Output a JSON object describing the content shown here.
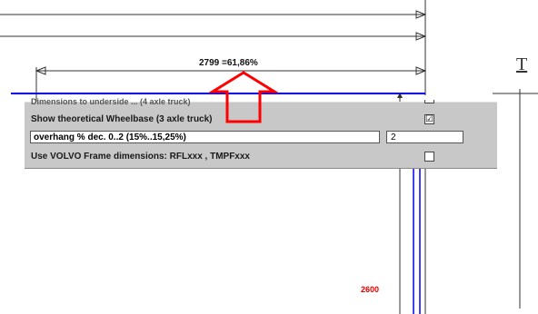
{
  "dimension_label": "2799 =61,86%",
  "red_label": "2600",
  "edge_letter": "T",
  "options": {
    "cut_row_text": "Dimensions to underside ... (4 axle truck)",
    "theoretical_wheelbase_label": "Show theoretical Wheelbase (3 axle truck)",
    "theoretical_wheelbase_checked": "☑",
    "overhang_label": "overhang %  dec. 0..2 (15%..15,25%)",
    "overhang_value": "2",
    "volvo_frame_label": "Use VOLVO Frame dimensions: RFLxxx , TMPFxxx",
    "volvo_frame_checked": ""
  },
  "colors": {
    "blue_line": "#0000ee",
    "arrow_red": "#ff0000",
    "red_label": "#e00000"
  }
}
